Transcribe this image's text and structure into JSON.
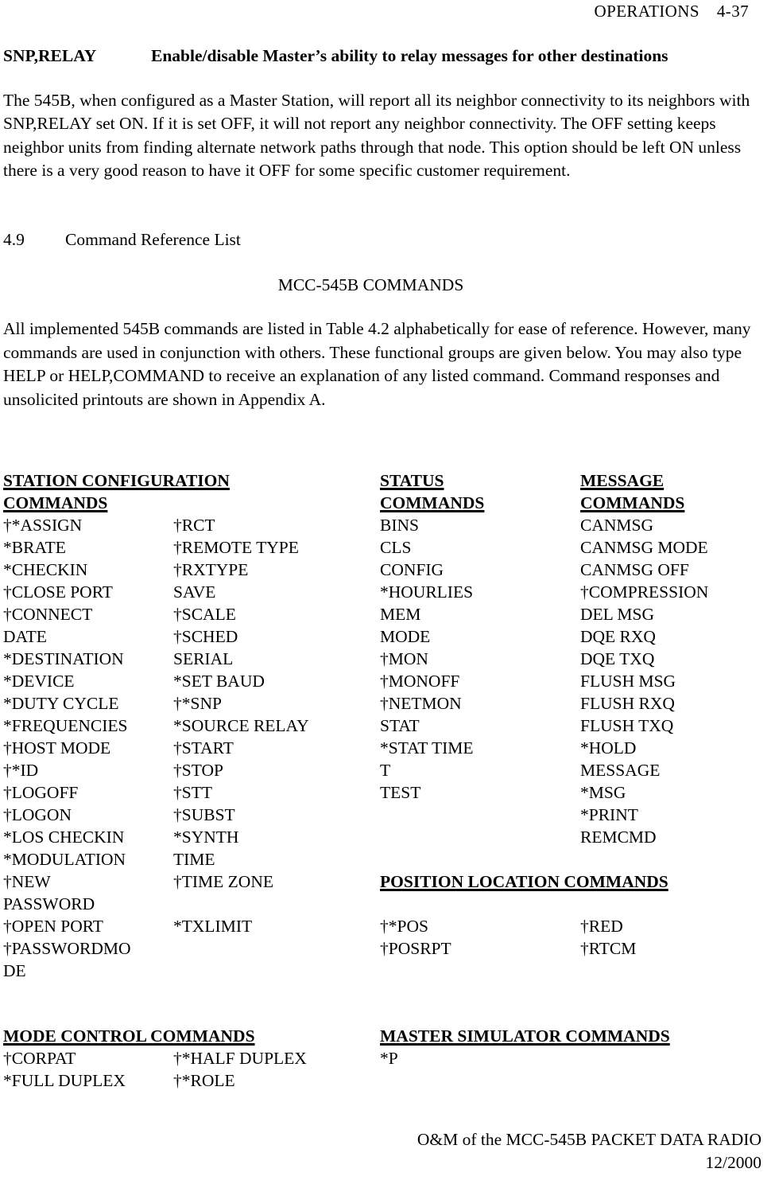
{
  "header": {
    "section": "OPERATIONS",
    "page_number": "4-37"
  },
  "command_entry": {
    "name": "SNP,RELAY",
    "description": "Enable/disable Master’s ability to relay messages for other destinations"
  },
  "body": {
    "paragraph1": "The 545B, when configured as a Master Station, will report all its neighbor connectivity to its neighbors with SNP,RELAY set ON.  If it is set OFF, it will not report any neighbor connectivity.  The OFF setting keeps neighbor units from finding alternate network paths through that node.  This option should be left ON unless there is a very good reason to have it OFF for some specific customer requirement."
  },
  "section": {
    "number": "4.9",
    "title": "Command Reference List",
    "center_title": "MCC-545B COMMANDS",
    "paragraph": "All implemented 545B commands are listed in Table 4.2 alphabetically for ease of reference.  However, many commands are used in conjunction with others.  These functional groups are given below.  You may also type HELP or HELP,COMMAND to receive an explanation of any listed command.  Command responses and unsolicited printouts are shown in Appendix A."
  },
  "groups": {
    "station_config": {
      "heading_line1": "STATION CONFIGURATION",
      "heading_line2": "COMMANDS"
    },
    "status": {
      "heading_line1": "STATUS",
      "heading_line2": "COMMANDS"
    },
    "message": {
      "heading_line1": "MESSAGE",
      "heading_line2": "COMMANDS"
    },
    "position_location": {
      "heading": "POSITION LOCATION COMMANDS"
    },
    "mode_control": {
      "heading": "MODE CONTROL COMMANDS"
    },
    "master_simulator": {
      "heading": "MASTER SIMULATOR COMMANDS"
    }
  },
  "table_rows": [
    {
      "c1": "†*ASSIGN",
      "c2": "†RCT",
      "c3": "BINS",
      "c4": "CANMSG"
    },
    {
      "c1": "*BRATE",
      "c2": "†REMOTE TYPE",
      "c3": "CLS",
      "c4": "CANMSG MODE"
    },
    {
      "c1": "*CHECKIN",
      "c2": "†RXTYPE",
      "c3": "CONFIG",
      "c4": "CANMSG OFF"
    },
    {
      "c1": "†CLOSE PORT",
      "c2": "SAVE",
      "c3": "*HOURLIES",
      "c4": "†COMPRESSION"
    },
    {
      "c1": "†CONNECT",
      "c2": "†SCALE",
      "c3": "MEM",
      "c4": "DEL MSG"
    },
    {
      "c1": "DATE",
      "c2": "†SCHED",
      "c3": "MODE",
      "c4": "DQE RXQ"
    },
    {
      "c1": "*DESTINATION",
      "c2": "SERIAL",
      "c3": "†MON",
      "c4": "DQE TXQ"
    },
    {
      "c1": "*DEVICE",
      "c2": "*SET BAUD",
      "c3": "†MONOFF",
      "c4": "FLUSH MSG"
    },
    {
      "c1": "*DUTY CYCLE",
      "c2": "†*SNP",
      "c3": "†NETMON",
      "c4": "FLUSH RXQ"
    },
    {
      "c1": "*FREQUENCIES",
      "c2": "*SOURCE RELAY",
      "c3": "STAT",
      "c4": "FLUSH TXQ"
    },
    {
      "c1": "†HOST MODE",
      "c2": "†START",
      "c3": "*STAT TIME",
      "c4": "*HOLD"
    },
    {
      "c1": "†*ID",
      "c2": "†STOP",
      "c3": "T",
      "c4": "MESSAGE"
    },
    {
      "c1": "†LOGOFF",
      "c2": "†STT",
      "c3": "TEST",
      "c4": "*MSG"
    },
    {
      "c1": "†LOGON",
      "c2": "†SUBST",
      "c3": "",
      "c4": "*PRINT"
    },
    {
      "c1": "*LOS CHECKIN",
      "c2": "*SYNTH",
      "c3": "",
      "c4": "REMCMD"
    },
    {
      "c1": "*MODULATION",
      "c2": "TIME",
      "c3": "",
      "c4": ""
    },
    {
      "c1": "†NEW",
      "c2": "†TIME ZONE",
      "c3": "",
      "c4": ""
    },
    {
      "c1": "PASSWORD",
      "c2": "",
      "c3": "",
      "c4": ""
    },
    {
      "c1": "†OPEN PORT",
      "c2": "*TXLIMIT",
      "c3": "†*POS",
      "c4": "†RED"
    },
    {
      "c1": "†PASSWORDMO",
      "c2": "",
      "c3": "†POSRPT",
      "c4": "†RTCM"
    },
    {
      "c1": "DE",
      "c2": "",
      "c3": "",
      "c4": ""
    }
  ],
  "lower_rows": [
    {
      "c1": "†CORPAT",
      "c2": "†*HALF DUPLEX",
      "c3": "*P"
    },
    {
      "c1": "*FULL DUPLEX",
      "c2": "†*ROLE",
      "c3": ""
    }
  ],
  "footer": {
    "line1": "O&M of the MCC-545B PACKET DATA RADIO",
    "line2": "12/2000"
  }
}
